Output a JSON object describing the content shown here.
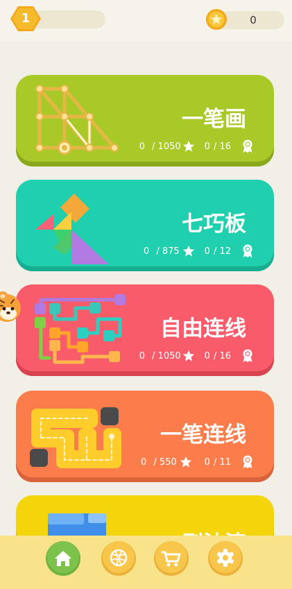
{
  "header": {
    "level": "1",
    "coins": "0"
  },
  "games": [
    {
      "title": "一笔画",
      "stars": "0",
      "stars_total": "/ 1050",
      "medals": "0",
      "medals_total": "/ 16",
      "icon": "one-stroke-drawing-icon"
    },
    {
      "title": "七巧板",
      "stars": "0",
      "stars_total": "/ 875",
      "medals": "0",
      "medals_total": "/ 12",
      "icon": "tangram-icon"
    },
    {
      "title": "自由连线",
      "stars": "0",
      "stars_total": "/ 1050",
      "medals": "0",
      "medals_total": "/ 16",
      "icon": "flow-connect-icon"
    },
    {
      "title": "一笔连线",
      "stars": "0",
      "stars_total": "/ 550",
      "medals": "0",
      "medals_total": "/ 11",
      "icon": "one-line-path-icon"
    },
    {
      "title": "刷油漆",
      "icon": "paint-blocks-icon"
    }
  ],
  "nav": [
    {
      "icon": "home-icon",
      "active": true
    },
    {
      "icon": "ball-icon",
      "active": false
    },
    {
      "icon": "cart-icon",
      "active": false
    },
    {
      "icon": "gear-icon",
      "active": false
    }
  ],
  "colors": {
    "card1": "#a8c928",
    "card2": "#1fcfae",
    "card3": "#f85b6a",
    "card4": "#fb7d4c",
    "card5": "#f4d40b",
    "nav_active": "#7cc24b",
    "nav_inactive": "#f7c64a"
  }
}
